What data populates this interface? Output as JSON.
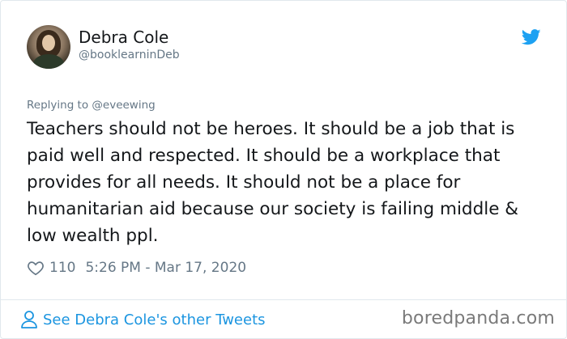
{
  "tweet": {
    "author_name": "Debra Cole",
    "author_handle": "@booklearninDeb",
    "replying_to": "Replying to @eveewing",
    "text": "Teachers should not be heroes. It should be a job that is paid well and respected. It should be a workplace that provides for all needs. It should not be a place for humanitarian aid because our society is failing middle & low wealth ppl.",
    "likes": "110",
    "timestamp": "5:26 PM - Mar 17, 2020",
    "see_more": "See Debra Cole's other Tweets"
  },
  "watermark": "boredpanda.com",
  "icons": {
    "brand": "twitter-bird-icon",
    "like": "heart-icon",
    "profile": "person-icon"
  },
  "colors": {
    "link": "#1b95e0",
    "muted": "#657786",
    "text": "#14171a",
    "twitter_blue": "#1da1f2"
  }
}
